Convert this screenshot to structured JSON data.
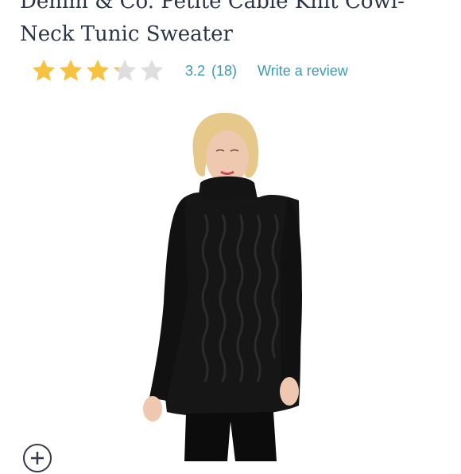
{
  "product": {
    "title": "Denim & Co. Petite Cable Knit Cowl-Neck Tunic Sweater",
    "rating_value": "3.2",
    "rating_count": "(18)",
    "rating_fraction": 0.64,
    "star_color": "#f5c242",
    "star_empty_color": "#dedede",
    "write_review_label": "Write a review",
    "image_icon": "product-photo",
    "zoom_icon": "zoom-in-icon"
  },
  "colors": {
    "title": "#2a3446",
    "link": "#3a9bb3"
  }
}
